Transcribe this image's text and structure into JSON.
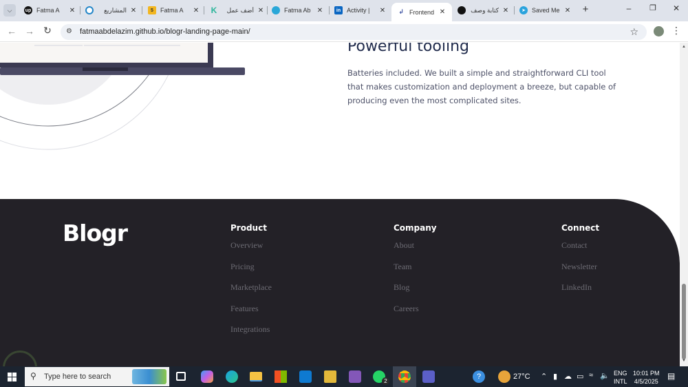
{
  "browser": {
    "tabs": [
      {
        "title": "Fatma A",
        "icon": "upwork-icon"
      },
      {
        "title": "المشاريع",
        "icon": "mostaql-icon"
      },
      {
        "title": "Fatma A",
        "icon": "khamsat-icon"
      },
      {
        "title": "أضف عمل",
        "icon": "kafiil-icon"
      },
      {
        "title": "Fatma Ab",
        "icon": "circle-site-icon"
      },
      {
        "title": "Activity |",
        "icon": "linkedin-icon"
      },
      {
        "title": "Frontend",
        "icon": "frontend-mentor-icon",
        "active": true
      },
      {
        "title": "كتابة وصف",
        "icon": "chatgpt-icon"
      },
      {
        "title": "Saved Me",
        "icon": "telegram-icon"
      }
    ],
    "url": "fatmaabdelazim.github.io/blogr-landing-page-main/"
  },
  "page": {
    "feature_title": "Powerful tooling",
    "feature_text": "Batteries included. We built a simple and straightforward CLI tool that makes customization and deployment a breeze, but capable of producing even the most complicated sites.",
    "footer": {
      "logo": "Blogr",
      "columns": [
        {
          "heading": "Product",
          "links": [
            "Overview",
            "Pricing",
            "Marketplace",
            "Features",
            "Integrations"
          ]
        },
        {
          "heading": "Company",
          "links": [
            "About",
            "Team",
            "Blog",
            "Careers"
          ]
        },
        {
          "heading": "Connect",
          "links": [
            "Contact",
            "Newsletter",
            "LinkedIn"
          ]
        }
      ]
    }
  },
  "taskbar": {
    "search_placeholder": "Type here to search",
    "weather": "27°C",
    "language": "ENG",
    "layout": "INTL",
    "time": "10:01 PM",
    "date": "4/5/2025",
    "whatsapp_badge": "2"
  },
  "colors": {
    "footer_bg": "#232127",
    "heading": "#1f2a4b",
    "link": "#6d6c74"
  }
}
